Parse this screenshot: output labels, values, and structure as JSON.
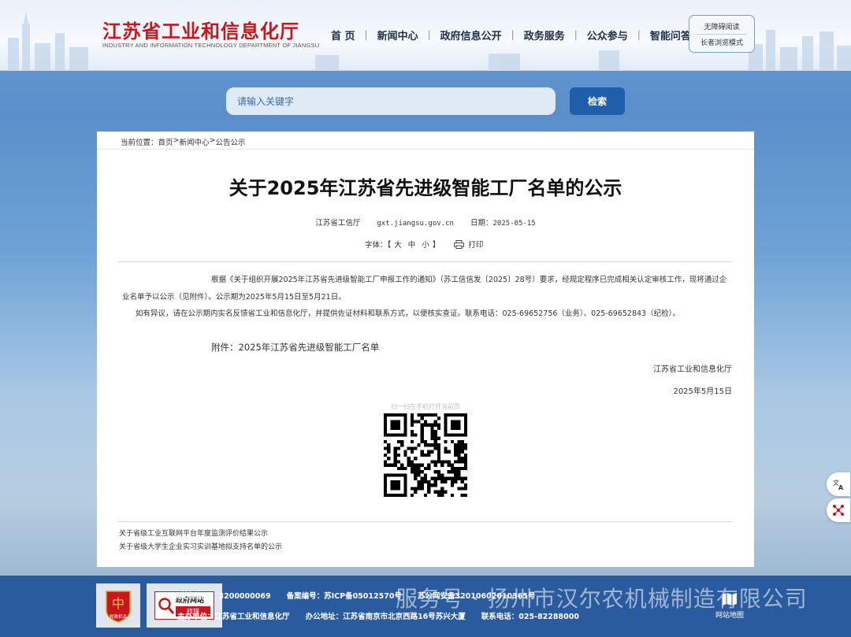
{
  "header": {
    "site_name": "江苏省工业和信息化厅",
    "site_name_en": "INDUSTRY AND INFORMATION TECHNOLOGY DEPARTMENT OF JIANGSU",
    "nav": [
      "首 页",
      "新闻中心",
      "政府信息公开",
      "政务服务",
      "公众参与",
      "智能问答"
    ],
    "accessibility": "无障碍阅读",
    "elder_mode": "长者浏览模式"
  },
  "search": {
    "placeholder": "请输入关键字",
    "button": "检索"
  },
  "breadcrumb": {
    "prefix": "当前位置：",
    "items": [
      "首页",
      "新闻中心",
      "公告公示"
    ],
    "sep": ">"
  },
  "article": {
    "title": "关于2025年江苏省先进级智能工厂名单的公示",
    "source": "江苏省工信厅",
    "domain": "gxt.jiangsu.gov.cn",
    "date_label": "日期：",
    "date": "2025-05-15",
    "font_label": "字体：【",
    "font_large": "大",
    "font_medium": "中",
    "font_small": "小",
    "font_end": "】",
    "print": "打印",
    "para1": "根据《关于组织开展2025年江苏省先进级智能工厂申报工作的通知》（苏工信信发〔2025〕28号）要求，经规定程序已完成相关认定审核工作，现将通过企业名单予以公示（见附件）。公示期为2025年5月15日至5月21日。",
    "para2": "如有异议，请在公示期内实名反馈省工业和信息化厅，并提供佐证材料和联系方式，以便核实查证。联系电话：025-69652756（业务）、025-69652843（纪检）。",
    "attach_label": "附件：",
    "attach_link": "2025年江苏省先进级智能工厂名单",
    "signature": "江苏省工业和信息化厅",
    "sign_date": "2025年5月15日",
    "qr_caption": "扫一扫在手机打开当前页"
  },
  "related": [
    "关于省级工业互联网平台年度监测评价结果公示",
    "关于省级大学生企业实习实训基地拟支持名单的公示"
  ],
  "footer": {
    "badge1": "党政机关",
    "badge2_title": "政府网站",
    "badge2_find": "找错",
    "line1": [
      "网站标识码：3200000069",
      "备案编号：苏ICP备05012570号",
      "苏公网安备32010602010365号"
    ],
    "line2": [
      "主办单位：江苏省工业和信息化厅",
      "办公地址：江苏省南京市北京西路16号苏兴大厦",
      "联系电话：025-82288000"
    ],
    "watermark": "服务号 · 扬州市汉尔农机械制造有限公司",
    "sitemap": "网站地图"
  },
  "colors": {
    "brand_red": "#c8161d",
    "primary_blue": "#1f5ea8",
    "footer_blue": "#2a5b9e"
  }
}
